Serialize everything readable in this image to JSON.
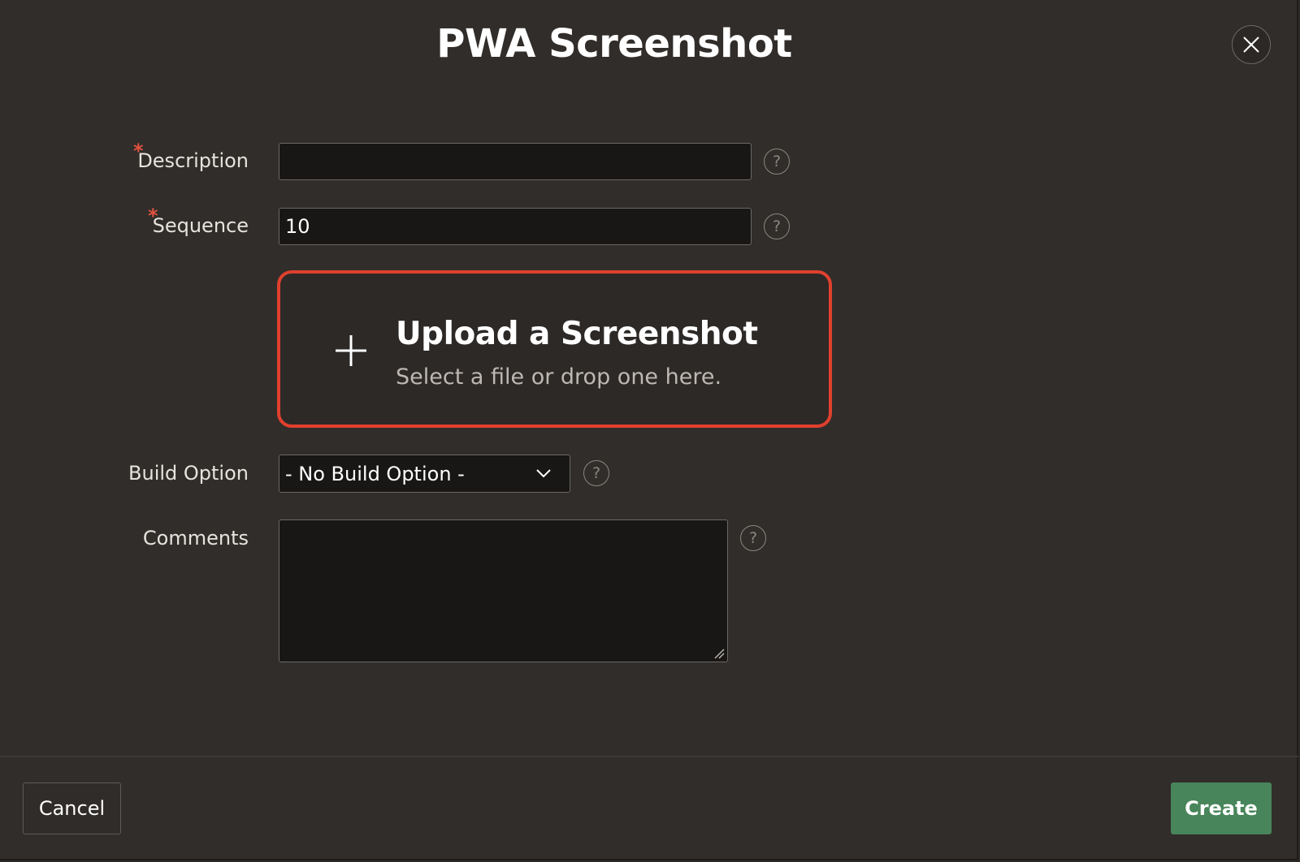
{
  "dialog": {
    "title": "PWA Screenshot",
    "close_icon": "close-icon"
  },
  "form": {
    "description": {
      "label": "Description",
      "required_mark": "*",
      "value": ""
    },
    "sequence": {
      "label": "Sequence",
      "required_mark": "*",
      "value": "10"
    },
    "upload": {
      "title": "Upload a Screenshot",
      "subtitle": "Select a file or drop one here.",
      "icon": "plus-icon",
      "border_color": "#e0402e"
    },
    "build_option": {
      "label": "Build Option",
      "selected": "- No Build Option -"
    },
    "comments": {
      "label": "Comments",
      "value": ""
    },
    "help_symbol": "?"
  },
  "footer": {
    "cancel_label": "Cancel",
    "create_label": "Create",
    "create_color": "#48855a"
  },
  "colors": {
    "background": "#312d2a",
    "required": "#e0533f"
  }
}
